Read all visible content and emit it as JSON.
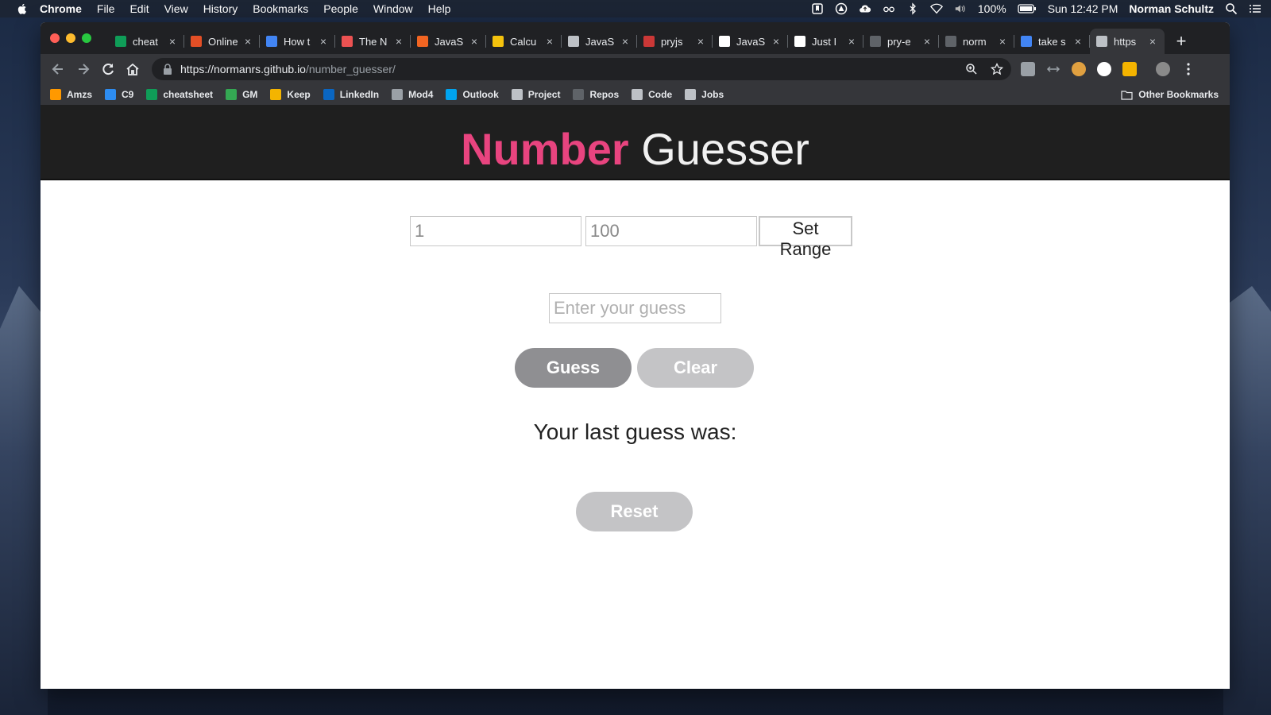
{
  "menubar": {
    "app": "Chrome",
    "items": [
      "File",
      "Edit",
      "View",
      "History",
      "Bookmarks",
      "People",
      "Window",
      "Help"
    ],
    "battery": "100%",
    "clock": "Sun 12:42 PM",
    "user": "Norman Schultz"
  },
  "tabs": [
    {
      "title": "cheat",
      "icon": "sheets-icon",
      "color": "#0f9d58"
    },
    {
      "title": "Online",
      "icon": "shield-icon",
      "color": "#e34f26"
    },
    {
      "title": "How t",
      "icon": "spinner-icon",
      "color": "#4285f4"
    },
    {
      "title": "The N",
      "icon": "udemy-icon",
      "color": "#ec5252"
    },
    {
      "title": "JavaS",
      "icon": "html-icon",
      "color": "#f26522"
    },
    {
      "title": "Calcu",
      "icon": "calc-icon",
      "color": "#f4c20d"
    },
    {
      "title": "JavaS",
      "icon": "page-icon",
      "color": "#bdc1c6"
    },
    {
      "title": "pryjs",
      "icon": "npm-icon",
      "color": "#cb3837"
    },
    {
      "title": "JavaS",
      "icon": "medium-icon",
      "color": "#ffffff"
    },
    {
      "title": "Just I",
      "icon": "dev-icon",
      "color": "#ffffff"
    },
    {
      "title": "pry-e",
      "icon": "github-icon",
      "color": "#5f6368"
    },
    {
      "title": "norm",
      "icon": "github-icon",
      "color": "#5f6368"
    },
    {
      "title": "take s",
      "icon": "google-icon",
      "color": "#4285f4"
    },
    {
      "title": "https",
      "icon": "page-icon",
      "color": "#bdc1c6",
      "active": true
    }
  ],
  "address": {
    "host": "https://normanrs.github.io",
    "path": "/number_guesser/"
  },
  "bookmarks": [
    {
      "label": "Amzs",
      "icon": "amazon-icon",
      "color": "#ff9900"
    },
    {
      "label": "C9",
      "icon": "cloud9-icon",
      "color": "#2d8cf0"
    },
    {
      "label": "cheatsheet",
      "icon": "sheets-icon",
      "color": "#0f9d58"
    },
    {
      "label": "GM",
      "icon": "maps-icon",
      "color": "#34a853"
    },
    {
      "label": "Keep",
      "icon": "keep-icon",
      "color": "#f4b400"
    },
    {
      "label": "LinkedIn",
      "icon": "linkedin-icon",
      "color": "#0a66c2"
    },
    {
      "label": "Mod4",
      "icon": "turing-icon",
      "color": "#9aa0a6"
    },
    {
      "label": "Outlook",
      "icon": "windows-icon",
      "color": "#00a4ef"
    },
    {
      "label": "Project",
      "icon": "page-icon",
      "color": "#bdc1c6"
    },
    {
      "label": "Repos",
      "icon": "github-icon",
      "color": "#5f6368"
    },
    {
      "label": "Code",
      "icon": "folder-icon",
      "color": "#bdc1c6"
    },
    {
      "label": "Jobs",
      "icon": "folder-icon",
      "color": "#bdc1c6"
    }
  ],
  "other_bookmarks": "Other Bookmarks",
  "app": {
    "title_bold": "Number",
    "title_light": "Guesser",
    "range_min": "1",
    "range_max": "100",
    "set_range_label": "Set Range",
    "guess_placeholder": "Enter your guess",
    "guess_label": "Guess",
    "clear_label": "Clear",
    "last_guess_text": "Your last guess was:",
    "reset_label": "Reset"
  },
  "colors": {
    "accent": "#e8447f",
    "header_bg": "#1f1f1f",
    "button_dark": "#8f8f92",
    "button_light": "#c4c4c6"
  }
}
